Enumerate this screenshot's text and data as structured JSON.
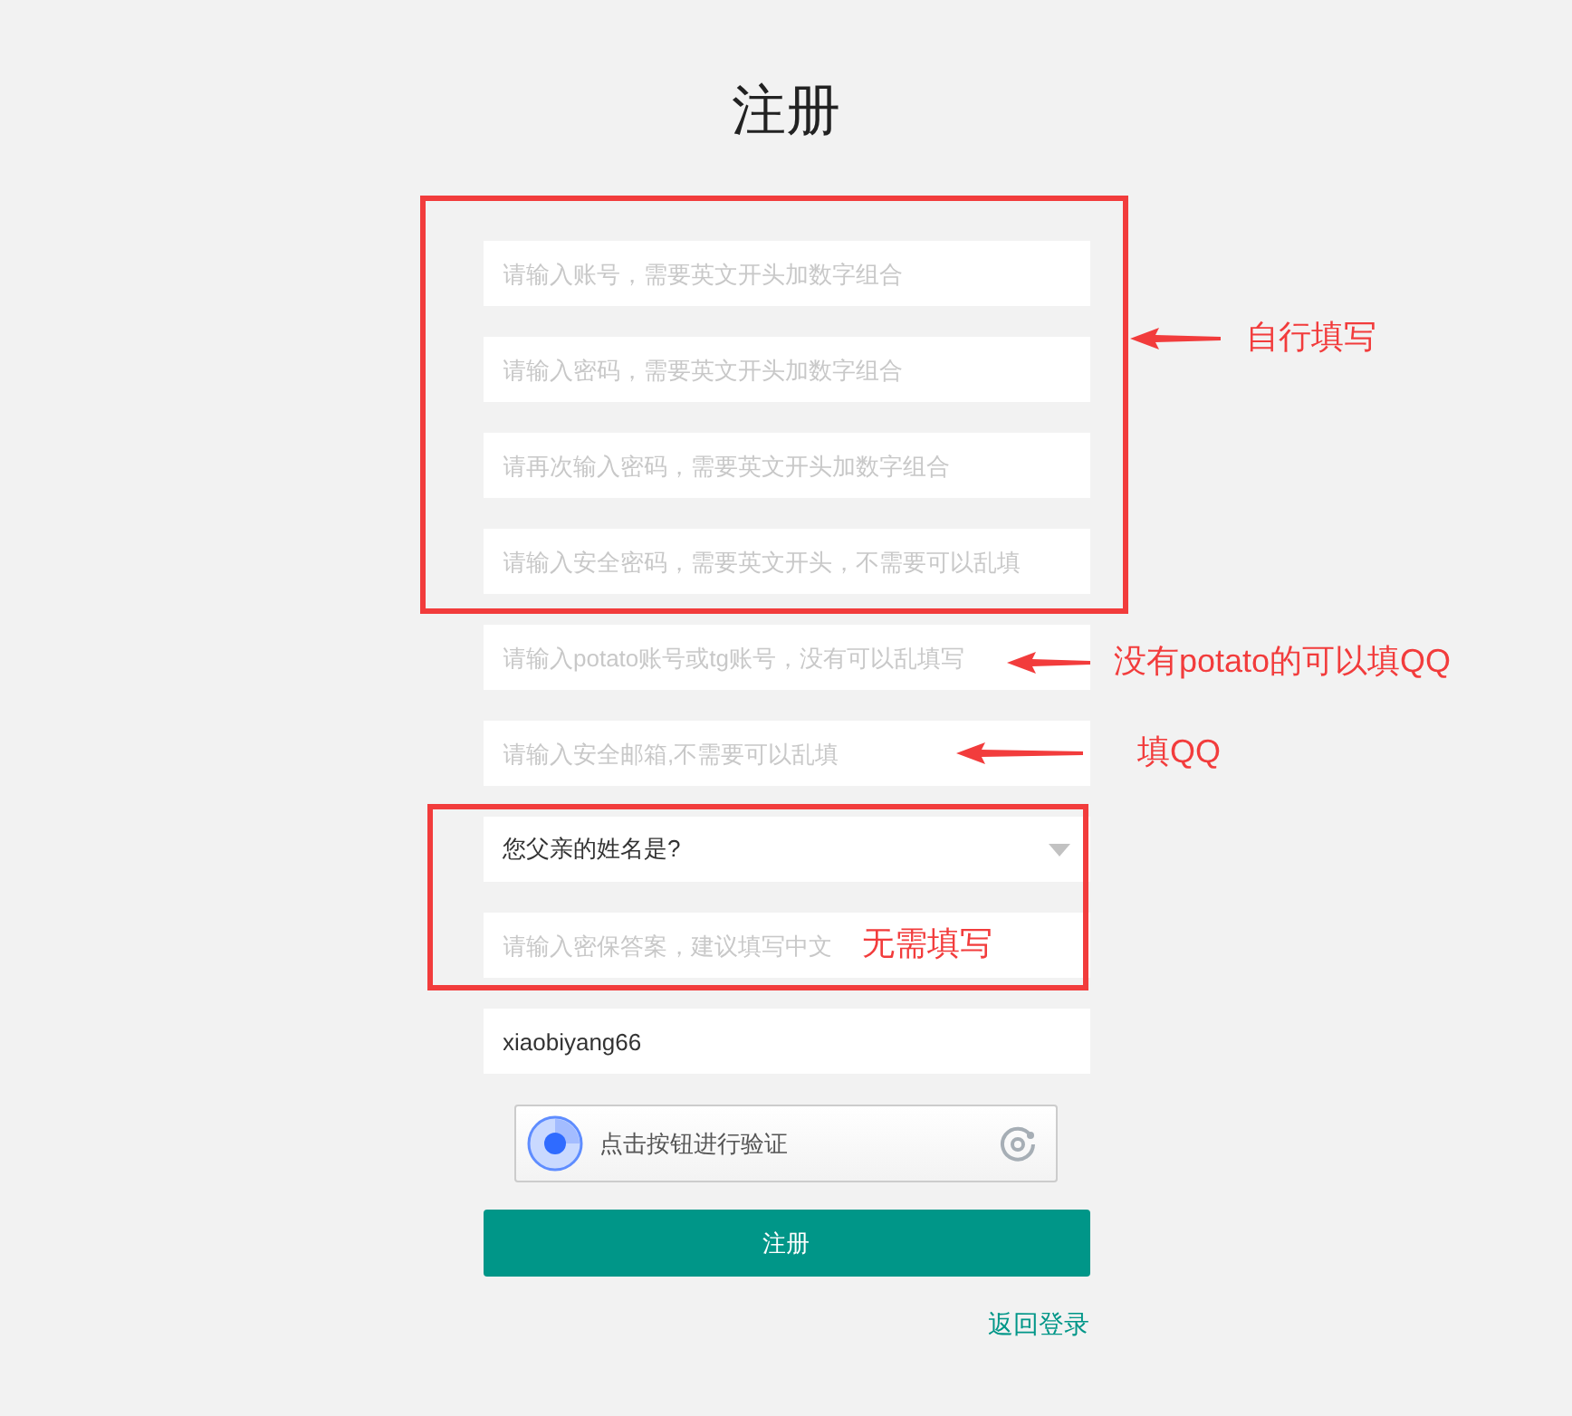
{
  "title": "注册",
  "fields": [
    {
      "kind": "input",
      "placeholder": "请输入账号，需要英文开头加数字组合"
    },
    {
      "kind": "input",
      "placeholder": "请输入密码，需要英文开头加数字组合"
    },
    {
      "kind": "input",
      "placeholder": "请再次输入密码，需要英文开头加数字组合"
    },
    {
      "kind": "input",
      "placeholder": "请输入安全密码，需要英文开头，不需要可以乱填"
    },
    {
      "kind": "input",
      "placeholder": "请输入potato账号或tg账号，没有可以乱填写"
    },
    {
      "kind": "input",
      "placeholder": "请输入安全邮箱,不需要可以乱填"
    },
    {
      "kind": "select",
      "value": "您父亲的姓名是?"
    },
    {
      "kind": "input",
      "placeholder": "请输入密保答案，建议填写中文"
    },
    {
      "kind": "input",
      "value": "xiaobiyang66"
    }
  ],
  "captcha": {
    "label": "点击按钮进行验证"
  },
  "submit": "注册",
  "back_link": "返回登录",
  "annotations": [
    {
      "kind": "arrow",
      "text": "自行填写"
    },
    {
      "kind": "arrow",
      "text": "没有potato的可以填QQ"
    },
    {
      "kind": "arrow",
      "text": "填QQ"
    },
    {
      "kind": "plain",
      "text": "无需填写"
    }
  ]
}
